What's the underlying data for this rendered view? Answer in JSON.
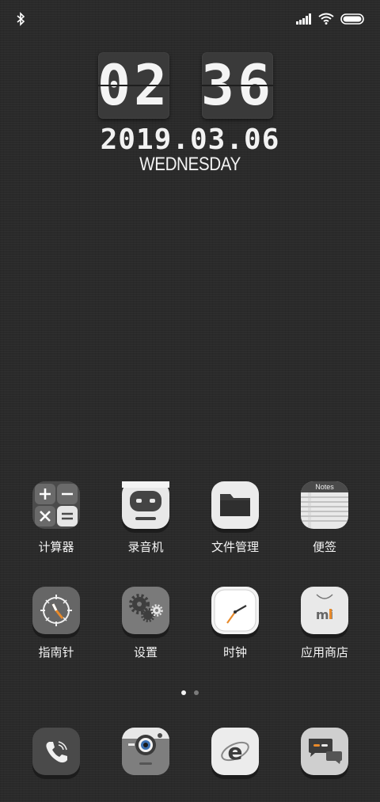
{
  "status_bar": {
    "left_icons": [
      "bluetooth-icon"
    ],
    "right_icons": [
      "signal-icon",
      "wifi-icon",
      "battery-icon"
    ]
  },
  "clock": {
    "hours": "02",
    "minutes": "36",
    "date": "2019.03.06",
    "weekday": "WEDNESDAY"
  },
  "apps": [
    {
      "label": "计算器",
      "icon": "calculator-icon"
    },
    {
      "label": "录音机",
      "icon": "recorder-icon"
    },
    {
      "label": "文件管理",
      "icon": "folder-icon"
    },
    {
      "label": "便签",
      "icon": "notes-icon",
      "icon_text": "Notes"
    },
    {
      "label": "指南针",
      "icon": "compass-icon"
    },
    {
      "label": "设置",
      "icon": "settings-gear-icon"
    },
    {
      "label": "时钟",
      "icon": "clock-icon"
    },
    {
      "label": "应用商店",
      "icon": "app-store-icon",
      "icon_text": "mi"
    }
  ],
  "page_indicator": {
    "total": 2,
    "active": 1
  },
  "dock": [
    {
      "icon": "phone-icon"
    },
    {
      "icon": "camera-icon"
    },
    {
      "icon": "browser-icon"
    },
    {
      "icon": "messages-icon"
    }
  ],
  "colors": {
    "background": "#2a2a2a",
    "icon_light": "#e9e9e9",
    "icon_dark": "#555555",
    "accent_orange": "#e98a2a"
  }
}
